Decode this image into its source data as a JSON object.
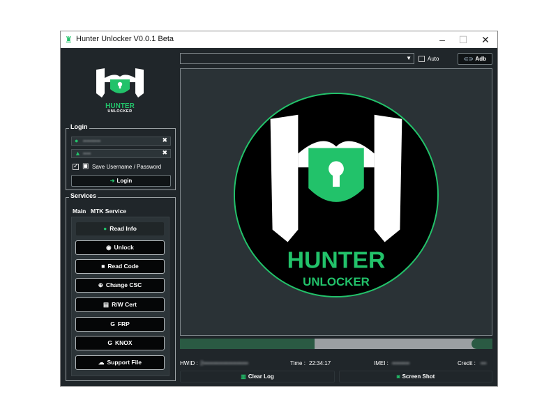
{
  "window": {
    "title": "Hunter Unlocker  V0.0.1 Beta"
  },
  "brand": {
    "line1": "HUNTER",
    "line2": "UNLOCKER"
  },
  "login": {
    "group_title": "Login",
    "username_value": "•••••••••",
    "password_value": "••••",
    "save_label": "Save Username / Password",
    "save_checked": true,
    "login_button": "Login"
  },
  "services": {
    "group_title": "Services",
    "tabs": [
      "Main",
      "MTK Service"
    ],
    "buttons": [
      "Read Info",
      "Unlock",
      "Read Code",
      "Change CSC",
      "R/W Cert",
      "FRP",
      "KNOX",
      "Support File"
    ]
  },
  "top": {
    "device_select_value": "",
    "auto_label": "Auto",
    "auto_checked": false,
    "adb_label": "Adb"
  },
  "progress": {
    "fraction": 0.43
  },
  "status": {
    "hwid_label": "HWID :",
    "hwid_value": "2•••••••••••••••••••••••",
    "time_label": "Time :",
    "time_value": "22:34:17",
    "imei_label": "IMEI :",
    "imei_value": "•••••••••",
    "credit_label": "Credit :",
    "credit_value": "•••"
  },
  "actions": {
    "clear_log": "Clear Log",
    "screen_shot": "Screen Shot"
  },
  "colors": {
    "accent": "#22c26a",
    "window_bg": "#20262a",
    "panel_bg": "#2a3236"
  }
}
